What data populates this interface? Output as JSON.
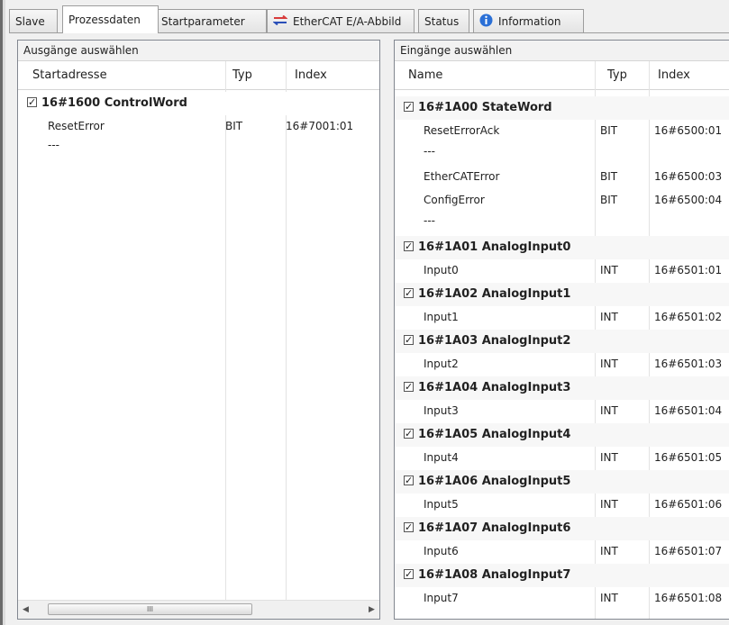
{
  "tabs": [
    {
      "label": "Slave",
      "active": false
    },
    {
      "label": "Prozessdaten",
      "active": true
    },
    {
      "label": "Startparameter",
      "active": false
    },
    {
      "label": "EtherCAT E/A-Abbild",
      "active": false,
      "icon": "ethercat-icon"
    },
    {
      "label": "Status",
      "active": false
    },
    {
      "label": "Information",
      "active": false,
      "icon": "info-icon"
    }
  ],
  "outputs": {
    "title": "Ausgänge auswählen",
    "columns": {
      "name": "Startadresse",
      "type": "Typ",
      "index": "Index"
    },
    "group": {
      "label": "16#1600 ControlWord",
      "checked": true
    },
    "rows": [
      {
        "name": "ResetError",
        "type": "BIT",
        "index": "16#7001:01"
      },
      {
        "name": "---",
        "type": "",
        "index": ""
      }
    ],
    "scrollbar": {
      "thumb_grip": "III"
    }
  },
  "inputs": {
    "title": "Eingänge auswählen",
    "columns": {
      "name": "Name",
      "type": "Typ",
      "index": "Index"
    },
    "groups": [
      {
        "label": "16#1A00 StateWord",
        "checked": true,
        "rows": [
          {
            "name": "ResetErrorAck",
            "type": "BIT",
            "index": "16#6500:01"
          },
          {
            "name": "---",
            "type": "",
            "index": ""
          },
          {
            "name": "EtherCATError",
            "type": "BIT",
            "index": "16#6500:03"
          },
          {
            "name": "ConfigError",
            "type": "BIT",
            "index": "16#6500:04"
          },
          {
            "name": "---",
            "type": "",
            "index": ""
          }
        ]
      },
      {
        "label": "16#1A01 AnalogInput0",
        "checked": true,
        "rows": [
          {
            "name": "Input0",
            "type": "INT",
            "index": "16#6501:01"
          }
        ]
      },
      {
        "label": "16#1A02 AnalogInput1",
        "checked": true,
        "rows": [
          {
            "name": "Input1",
            "type": "INT",
            "index": "16#6501:02"
          }
        ]
      },
      {
        "label": "16#1A03 AnalogInput2",
        "checked": true,
        "rows": [
          {
            "name": "Input2",
            "type": "INT",
            "index": "16#6501:03"
          }
        ]
      },
      {
        "label": "16#1A04 AnalogInput3",
        "checked": true,
        "rows": [
          {
            "name": "Input3",
            "type": "INT",
            "index": "16#6501:04"
          }
        ]
      },
      {
        "label": "16#1A05 AnalogInput4",
        "checked": true,
        "rows": [
          {
            "name": "Input4",
            "type": "INT",
            "index": "16#6501:05"
          }
        ]
      },
      {
        "label": "16#1A06 AnalogInput5",
        "checked": true,
        "rows": [
          {
            "name": "Input5",
            "type": "INT",
            "index": "16#6501:06"
          }
        ]
      },
      {
        "label": "16#1A07 AnalogInput6",
        "checked": true,
        "rows": [
          {
            "name": "Input6",
            "type": "INT",
            "index": "16#6501:07"
          }
        ]
      },
      {
        "label": "16#1A08 AnalogInput7",
        "checked": true,
        "rows": [
          {
            "name": "Input7",
            "type": "INT",
            "index": "16#6501:08"
          }
        ]
      }
    ]
  },
  "colors": {
    "accent": "#2a6fd6",
    "ethercat_red": "#d83b3b",
    "ethercat_blue": "#2a4fb8"
  }
}
